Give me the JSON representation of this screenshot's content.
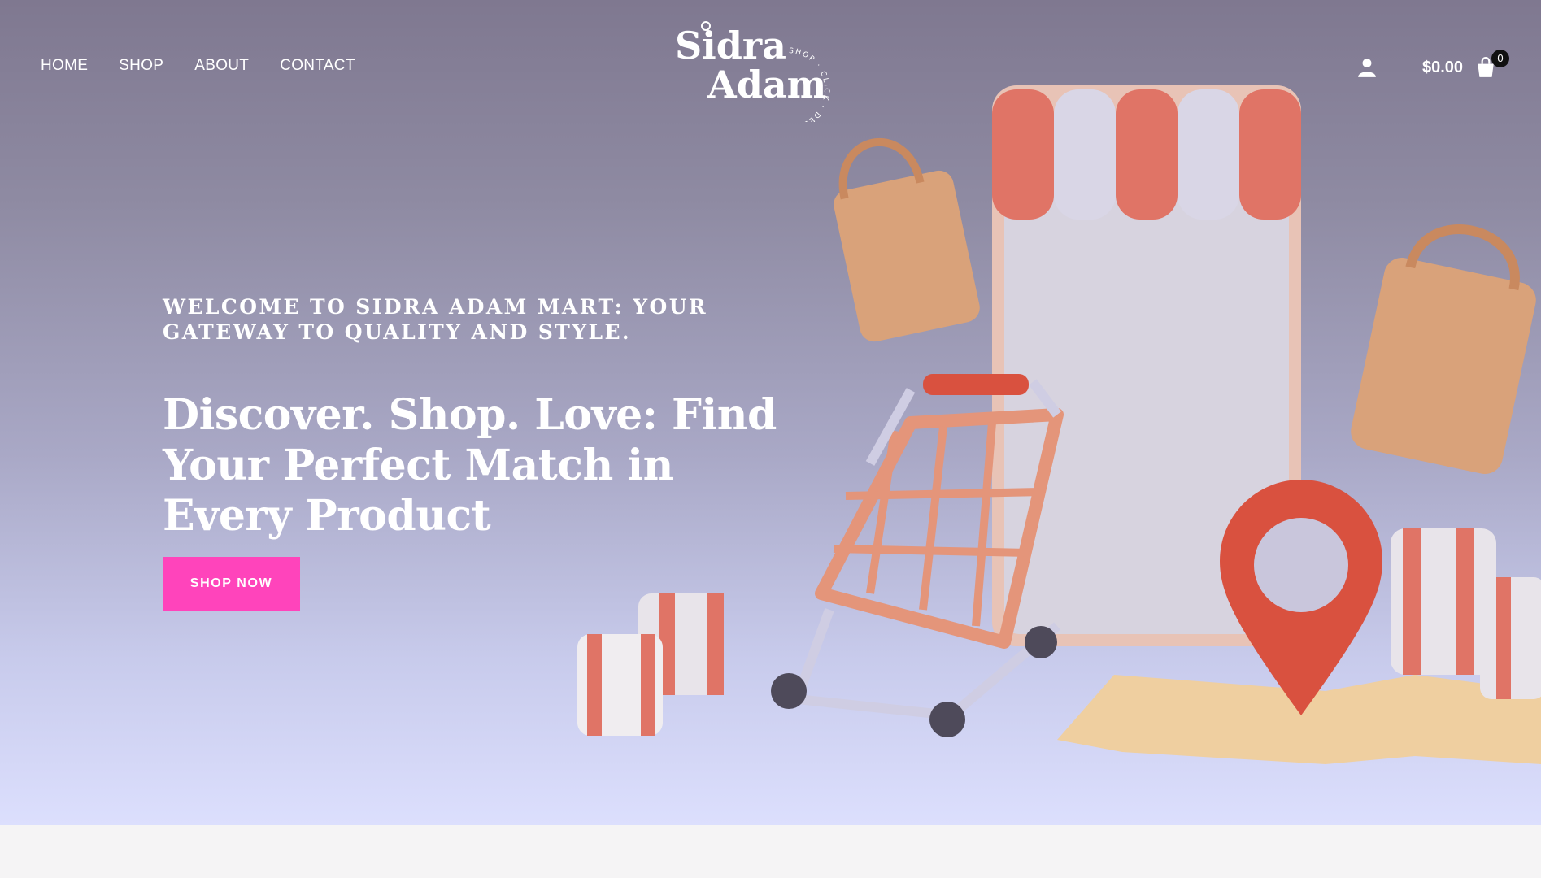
{
  "header": {
    "nav": [
      "HOME",
      "SHOP",
      "ABOUT",
      "CONTACT"
    ],
    "logo": {
      "line1": "Sidra",
      "line2": "Adam",
      "ring_text": "SHOP · CLICK · DELIGHT ·"
    },
    "cart_total": "$0.00",
    "cart_count": "0"
  },
  "hero": {
    "welcome": "WELCOME TO SIDRA ADAM MART: YOUR GATEWAY TO QUALITY AND STYLE.",
    "headline": "Discover. Shop. Love: Find Your Perfect Match in Every Product",
    "cta_label": "SHOP NOW"
  },
  "colors": {
    "accent": "#ff44bb",
    "awning_red": "#e07466",
    "awning_white": "#d9d6e6",
    "bag": "#d9a27a",
    "pin": "#d9513f"
  },
  "icons": [
    "user-icon",
    "shopping-bag-icon"
  ]
}
